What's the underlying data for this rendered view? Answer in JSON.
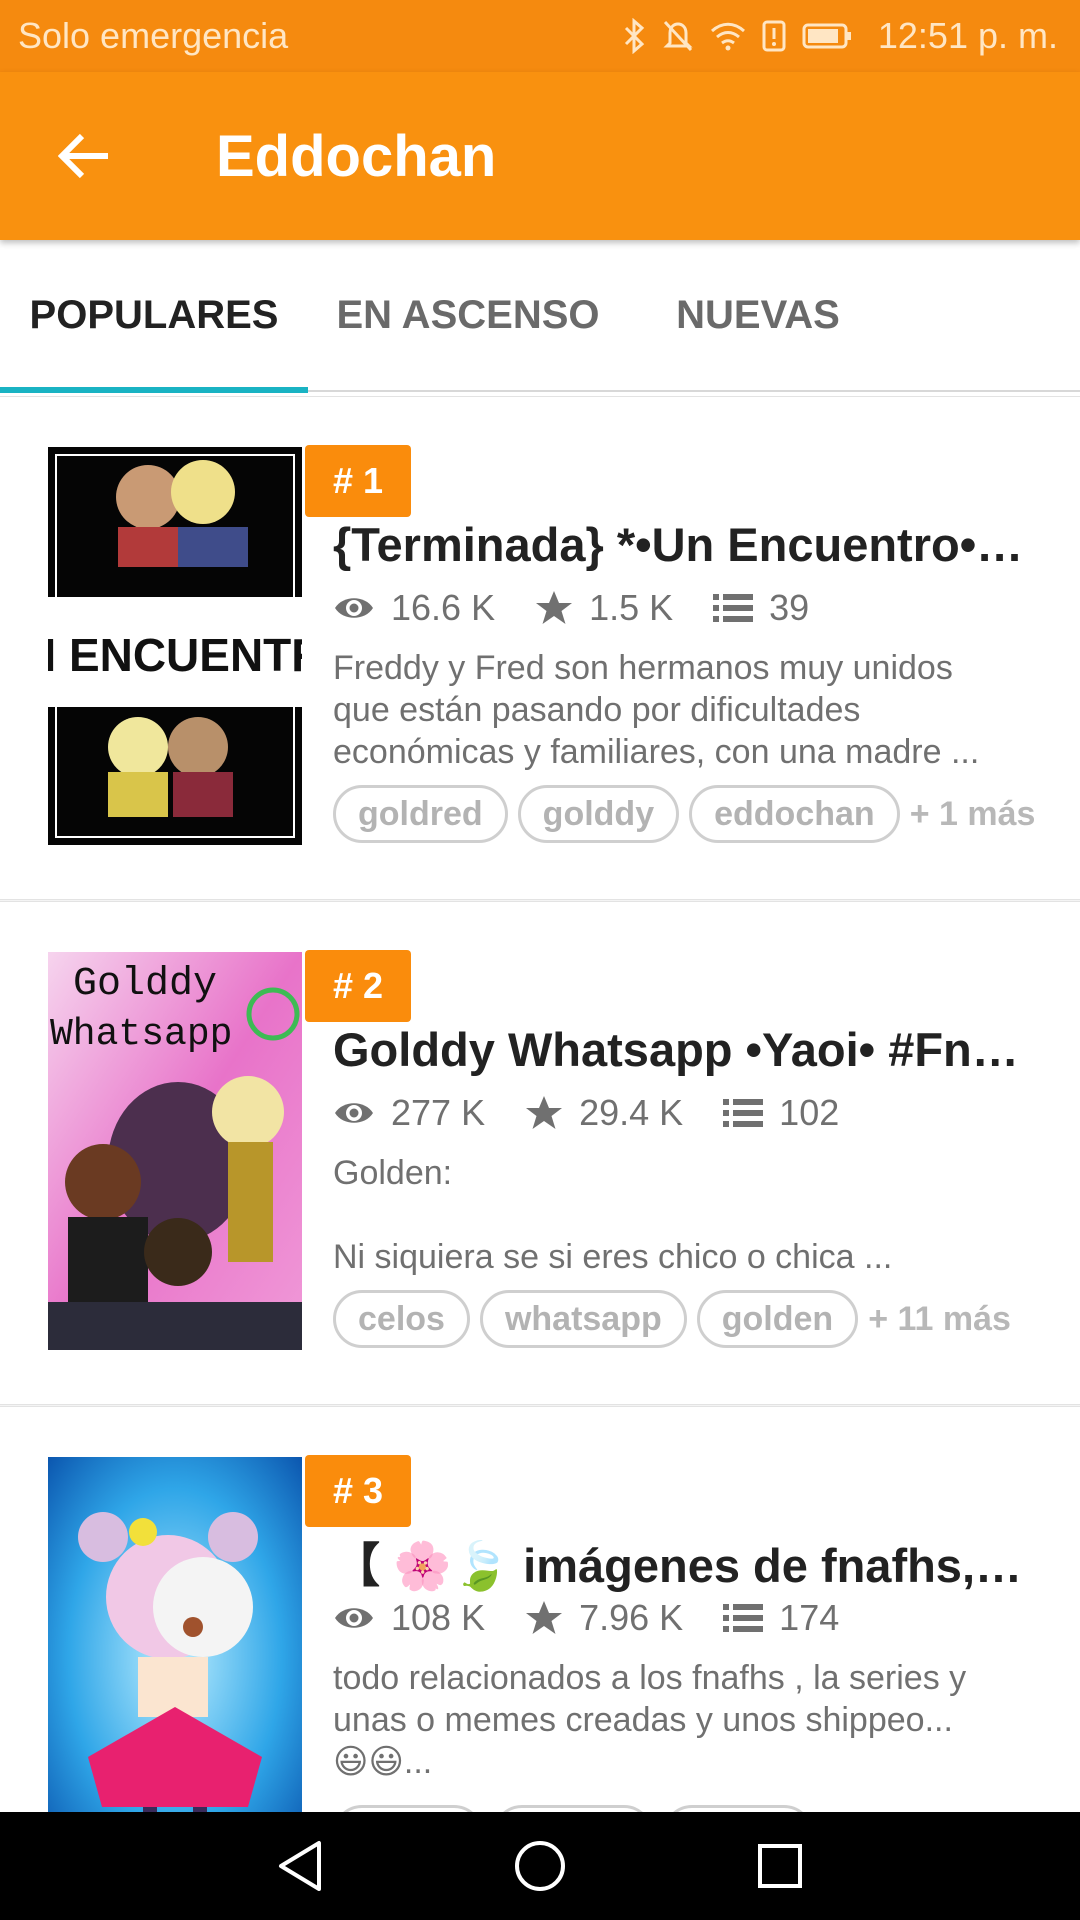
{
  "status_bar": {
    "carrier": "Solo emergencia",
    "time": "12:51 p. m.",
    "icons": [
      "bluetooth-icon",
      "mute-icon",
      "wifi-icon",
      "alert-icon",
      "battery-icon"
    ]
  },
  "app_bar": {
    "title": "Eddochan",
    "back_icon": "arrow-left-icon",
    "color": "#f9910f"
  },
  "tabs": [
    {
      "label": "POPULARES",
      "active": true
    },
    {
      "label": "EN ASCENSO",
      "active": false
    },
    {
      "label": "NUEVAS",
      "active": false
    }
  ],
  "stories": [
    {
      "rank": "# 1",
      "title": "{Terminada} *•Un Encuentro•* [...",
      "views": "16.6 K",
      "votes": "1.5 K",
      "parts": "39",
      "description": "Freddy y Fred son hermanos muy unidos\nque están pasando  por dificultades\neconómicas y familiares, con una madre ...",
      "tags": [
        "goldred",
        "golddy",
        "eddochan"
      ],
      "more": "+ 1 más",
      "cover_text": "UN ENCUENTRO"
    },
    {
      "rank": "# 2",
      "title": "Golddy Whatsapp •Yaoi• #Fnaf...",
      "views": "277 K",
      "votes": "29.4 K",
      "parts": "102",
      "description": "Golden:\n\nNi siquiera se si eres chico o chica ...",
      "tags": [
        "celos",
        "whatsapp",
        "golden"
      ],
      "more": "+ 11 más",
      "cover_text_1": "Golddy",
      "cover_text_2": "Whatsapp"
    },
    {
      "rank": "# 3",
      "title": "【 🌸🍃 imágenes de fnafhs, m...",
      "views": "108 K",
      "votes": "7.96 K",
      "parts": "174",
      "description": "todo relacionados a los fnafhs , la series y\nunas o memes  creadas y unos shippeo...\n😃😃...",
      "tags": [
        "",
        "",
        ""
      ],
      "more": ""
    }
  ],
  "colors": {
    "accent": "#f9910f",
    "rank_badge": "#fa8c0c",
    "tab_indicator": "#19b3c3"
  }
}
